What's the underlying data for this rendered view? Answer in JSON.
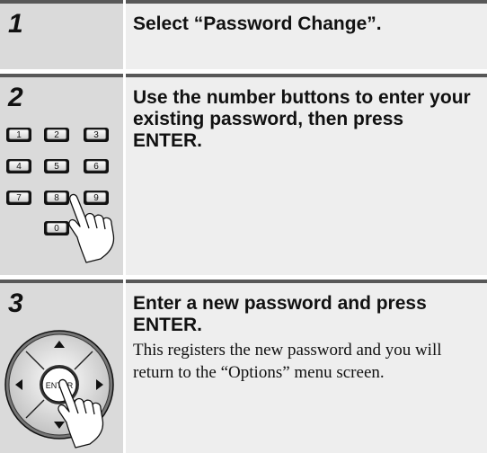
{
  "steps": [
    {
      "number": "1",
      "title": "Select “Password Change”."
    },
    {
      "number": "2",
      "title": "Use the number buttons to enter your existing password, then press ENTER.",
      "keypad": [
        "1",
        "2",
        "3",
        "4",
        "5",
        "6",
        "7",
        "8",
        "9",
        "0"
      ]
    },
    {
      "number": "3",
      "title": "Enter a new password and press ENTER.",
      "body": "This registers the new password and you will return to the “Options” menu screen.",
      "enter_label": "ENTER"
    }
  ],
  "icons": [
    "keypad-illustration",
    "pointing-hand-icon",
    "arrow-pad-illustration"
  ]
}
